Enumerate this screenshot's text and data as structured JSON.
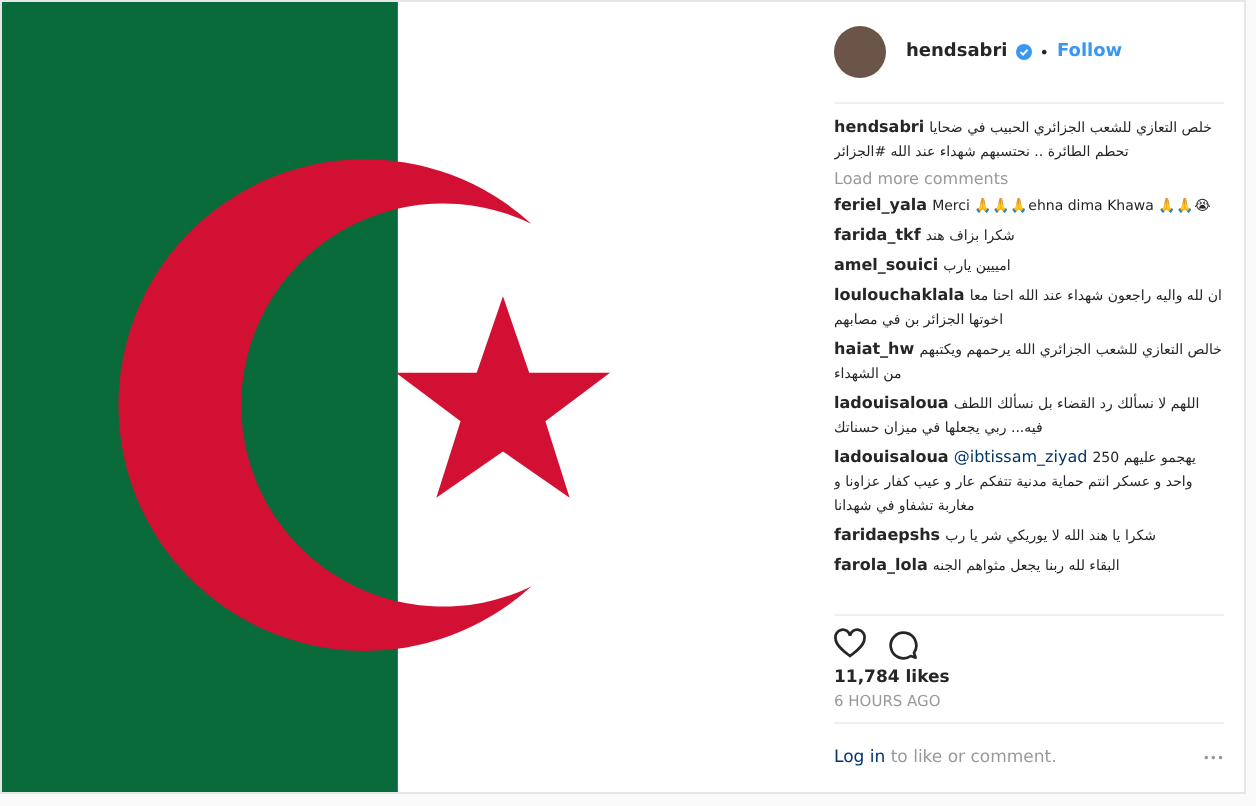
{
  "header": {
    "username": "hendsabri",
    "verified": true,
    "separator": "•",
    "follow": "Follow"
  },
  "caption": {
    "username": "hendsabri",
    "text": "خلص التعازي للشعب الجزائري الحبيب في ضحايا تحطم الطائرة .. نحتسبهم شهداء عند الله #الجزائر"
  },
  "load_more": "Load more comments",
  "comments": [
    {
      "username": "feriel_yala",
      "text": "Merci 🙏🙏🙏ehna dima Khawa 🙏🙏😭"
    },
    {
      "username": "farida_tkf",
      "text": "شكرا بزاف هند"
    },
    {
      "username": "amel_souici",
      "text": "امييين يارب"
    },
    {
      "username": "loulouchaklala",
      "text": "ان لله واليه راجعون شهداء عند الله احنا معا اخوتها الجزائر بن في مصابهم"
    },
    {
      "username": "haiat_hw",
      "text": "خالص التعازي للشعب الجزائري الله يرحمهم ويكتبهم من الشهداء"
    },
    {
      "username": "ladouisaloua",
      "text": "اللهم لا نسألك رد القضاء بل نسألك اللطف فيه... ربي يجعلها في ميزان حسناتك"
    },
    {
      "username": "ladouisaloua",
      "mention": "@ibtissam_ziyad",
      "text": "يهجمو عليهم 250 واحد و عسكر انتم حماية مدنية تتفكم عار و عيب كفار عزاونا و مغاربة تشفاو في شهدانا"
    },
    {
      "username": "faridaepshs",
      "text": "شكرا يا هند الله لا يوريكي شر يا رب"
    },
    {
      "username": "farola_lola",
      "text": "البقاء لله ربنا يجعل مثواهم الجنه"
    }
  ],
  "likes": "11,784 likes",
  "time": "6 HOURS AGO",
  "login": {
    "link": "Log in",
    "rest": "to like or comment."
  },
  "more": "•••"
}
